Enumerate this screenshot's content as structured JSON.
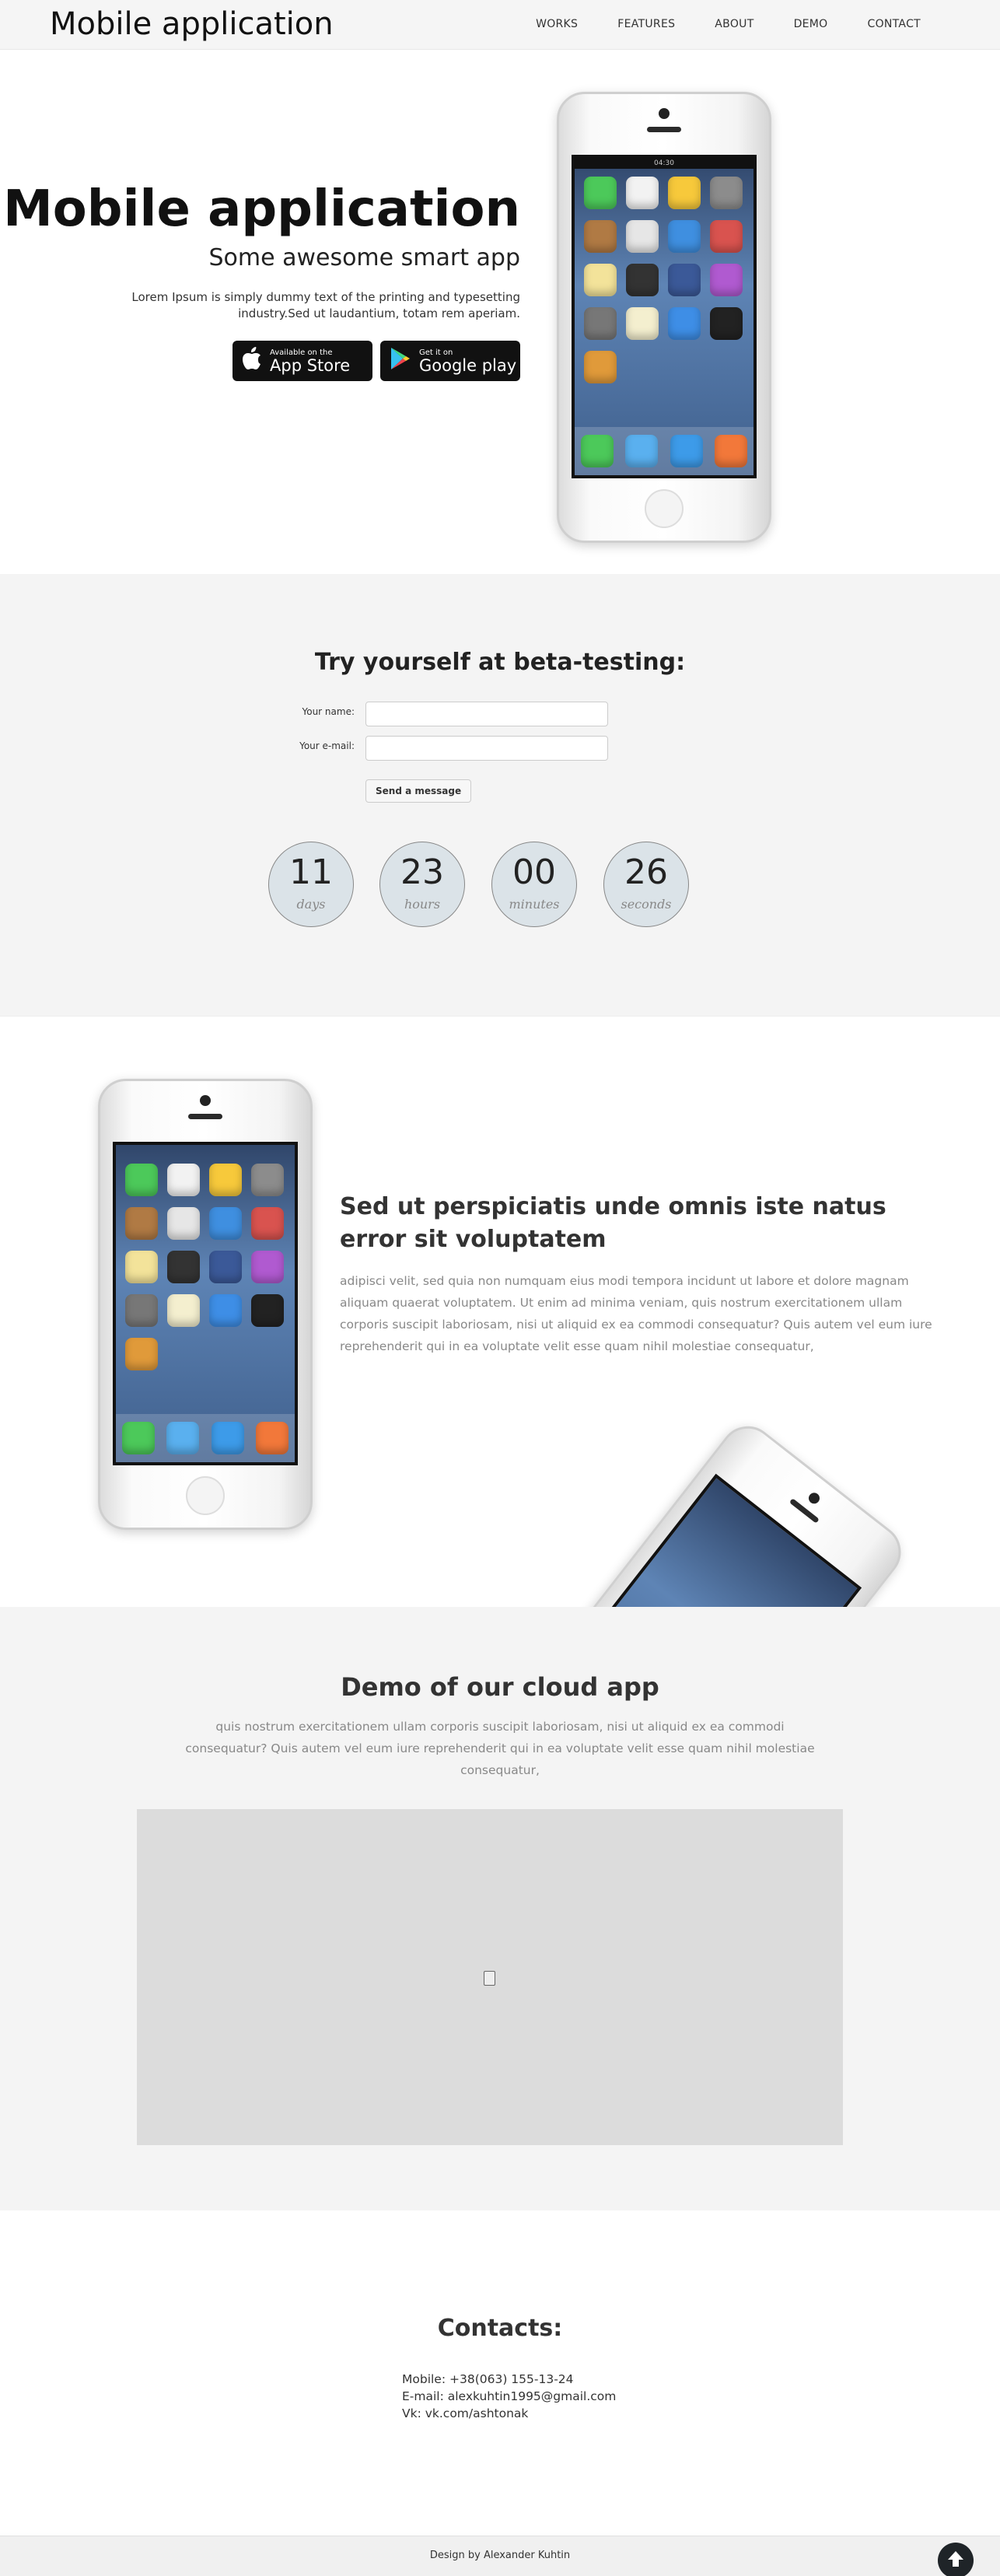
{
  "header": {
    "brand": "Mobile application",
    "nav": [
      {
        "label": "WORKS"
      },
      {
        "label": "FEATURES"
      },
      {
        "label": "ABOUT"
      },
      {
        "label": "DEMO"
      },
      {
        "label": "CONTACT"
      }
    ]
  },
  "hero": {
    "title": "Mobile application",
    "subtitle": "Some awesome smart app",
    "text": "Lorem Ipsum is simply dummy text of the printing and typesetting industry.Sed ut laudantium, totam rem aperiam.",
    "app_store": {
      "small": "Available on the",
      "big": "App Store",
      "icon": "apple-icon"
    },
    "google_play": {
      "small": "Get it on",
      "big": "Google play",
      "icon": "play-icon"
    },
    "phone_time": "04:30"
  },
  "beta": {
    "title": "Try yourself at beta-testing:",
    "name_label": "Your name:",
    "email_label": "Your e-mail:",
    "name_value": "",
    "email_value": "",
    "send_label": "Send a message",
    "timers": [
      {
        "value": "11",
        "label": "days"
      },
      {
        "value": "23",
        "label": "hours"
      },
      {
        "value": "00",
        "label": "minutes"
      },
      {
        "value": "26",
        "label": "seconds"
      }
    ]
  },
  "features": {
    "title": "Sed ut perspiciatis unde omnis iste natus error sit voluptatem",
    "text": "adipisci velit, sed quia non numquam eius modi tempora incidunt ut labore et dolore magnam aliquam quaerat voluptatem. Ut enim ad minima veniam, quis nostrum exercitationem ullam corporis suscipit laboriosam, nisi ut aliquid ex ea commodi consequatur? Quis autem vel eum iure reprehenderit qui in ea voluptate velit esse quam nihil molestiae consequatur,"
  },
  "demo": {
    "title": "Demo of our cloud app",
    "text": "quis nostrum exercitationem ullam corporis suscipit laboriosam, nisi ut aliquid ex ea commodi consequatur? Quis autem vel eum iure reprehenderit qui in ea voluptate velit esse quam nihil molestiae consequatur,",
    "placeholder_icon": "broken-document-icon"
  },
  "contacts": {
    "title": "Contacts:",
    "mobile": "Mobile: +38(063) 155-13-24",
    "email": "E-mail: alexkuhtin1995@gmail.com",
    "vk": "Vk: vk.com/ashtonak"
  },
  "footer": {
    "text": "Design by Alexander Kuhtin",
    "scroll_top_icon": "arrow-up-icon"
  },
  "colors": {
    "section_bg": "#f4f4f4",
    "timer_bg": "#dbe3e8",
    "text_muted": "#888888",
    "button_dark": "#111111"
  }
}
